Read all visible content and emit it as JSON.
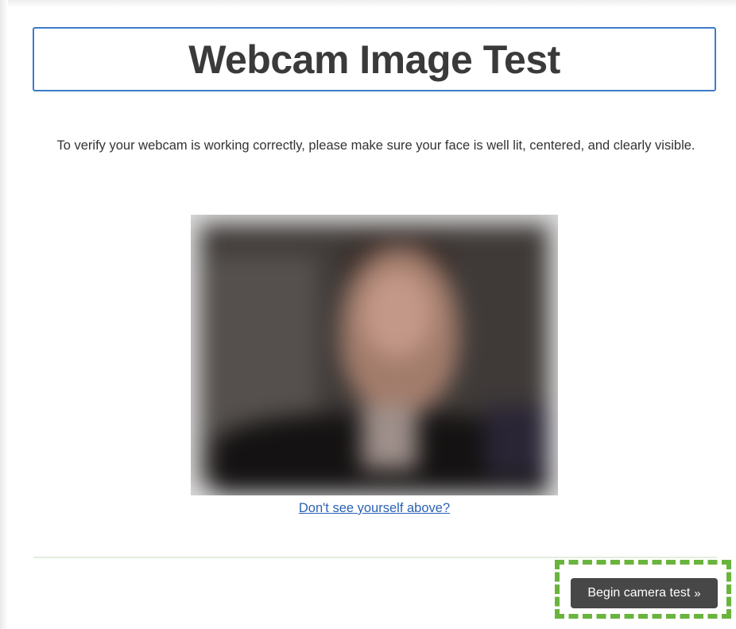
{
  "header": {
    "title": "Webcam Image Test"
  },
  "main": {
    "instructions": "To verify your webcam is working correctly, please make sure your face is well lit, centered, and clearly visible.",
    "help_link": "Don't see yourself above?"
  },
  "footer": {
    "begin_button_label": "Begin camera test",
    "begin_button_icon": "double-chevron-right-icon"
  },
  "colors": {
    "title_border": "#3d7cc9",
    "link": "#2a62b3",
    "button_bg": "#474747",
    "highlight_dashed": "#6ab43e",
    "divider": "#e3eedd"
  }
}
